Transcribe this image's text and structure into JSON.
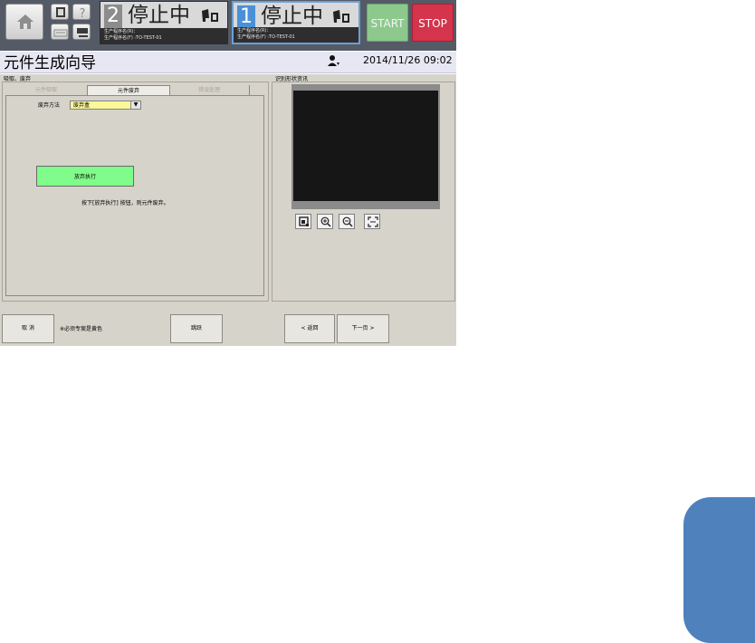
{
  "header": {
    "lanes": [
      {
        "number": "2",
        "state": "停止中",
        "program_line1": "生产程序名(R)：",
        "program_line2": "生产程序名(F) :TO-TEST-01",
        "number_color": "#8c8c8c"
      },
      {
        "number": "1",
        "state": "停止中",
        "program_line1": "生产程序名(R)：",
        "program_line2": "生产程序名(F) :TO-TEST-01",
        "number_color": "#4a90d9"
      }
    ],
    "start_label": "START",
    "stop_label": "STOP"
  },
  "titlebar": {
    "title": "元件生成向导",
    "datetime": "2014/11/26 09:02"
  },
  "left_panel": {
    "group_label": "吸取、废弃",
    "tabs": [
      "元件吸取",
      "元件废弃",
      "错误处理"
    ],
    "active_tab": 1,
    "method_label": "废弃方法",
    "method_value": "废弃盒",
    "execute_label": "放弃执行",
    "hint": "按下[放弃执行] 按钮，则元件废弃。"
  },
  "right_panel": {
    "group_label": "识别形状资讯"
  },
  "footer": {
    "cancel_label": "取 消",
    "required_note": "※必须专案是黄色",
    "skip_label": "跳跃",
    "back_label": "< 返回",
    "next_label": "下一页 >"
  },
  "colors": {
    "header_bg": "#555b66",
    "start": "#8dc98d",
    "stop": "#d4344c",
    "execute": "#80fc8a",
    "required_field": "#fbf89a",
    "corner_tab": "#4f81bd"
  },
  "icons": [
    "home-icon",
    "display-icon",
    "help-icon",
    "keyboard-icon",
    "monitor-icon",
    "feeder-icon",
    "user-icon",
    "fit-image-icon",
    "zoom-in-icon",
    "zoom-out-icon",
    "expand-icon"
  ]
}
